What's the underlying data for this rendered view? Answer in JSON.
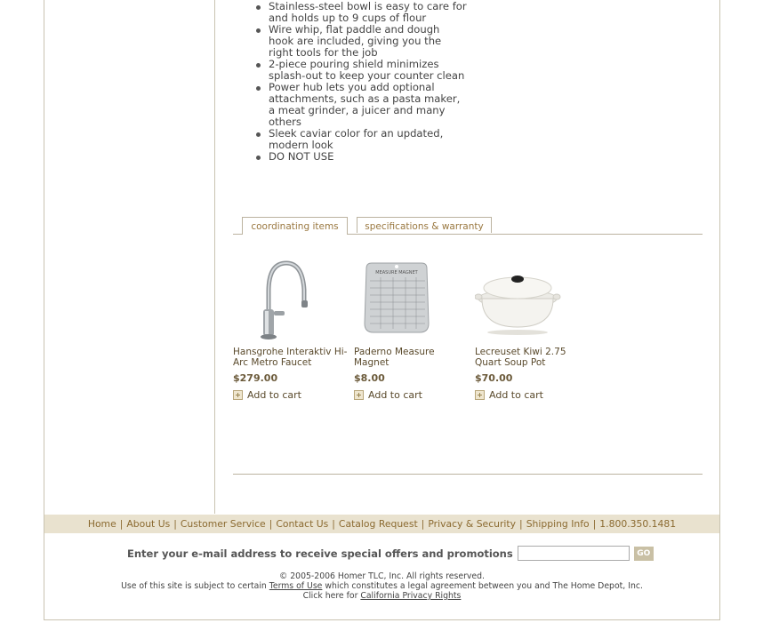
{
  "features": [
    "Stainless-steel bowl is easy to care for and holds up to 9 cups of flour",
    "Wire whip, flat paddle and dough hook are included, giving you the right tools for the job",
    "2-piece pouring shield minimizes splash-out to keep your counter clean",
    "Power hub lets you add optional attachments, such as a pasta maker, a meat grinder, a juicer and many others",
    "Sleek caviar color for an updated, modern look",
    "DO NOT USE"
  ],
  "tabs": [
    "coordinating items",
    "specifications & warranty"
  ],
  "products": [
    {
      "name": "Hansgrohe Interaktiv Hi-Arc Metro Faucet",
      "price": "$279.00",
      "add": "Add to cart",
      "image": "faucet"
    },
    {
      "name": "Paderno Measure Magnet",
      "price": "$8.00",
      "add": "Add to cart",
      "image": "measure-magnet"
    },
    {
      "name": "Lecreuset Kiwi 2.75 Quart Soup Pot",
      "price": "$70.00",
      "add": "Add to cart",
      "image": "soup-pot"
    }
  ],
  "magnet_text": "MEASURE MAGNET",
  "footer_nav": [
    "Home",
    "About Us",
    "Customer Service",
    "Contact Us",
    "Catalog Request",
    "Privacy & Security",
    "Shipping Info",
    "1.800.350.1481"
  ],
  "signup": {
    "label": "Enter your e-mail address to receive special offers and promotions",
    "button": "GO",
    "placeholder": ""
  },
  "legal": {
    "copyright": "© 2005-2006 Homer TLC, Inc. All rights reserved.",
    "terms_prefix": "Use of this site is subject to certain",
    "terms_link": "Terms of Use",
    "terms_suffix": "which constitutes a legal agreement between you and The Home Depot, Inc.",
    "privacy_prefix": "Click here for",
    "privacy_link": "California Privacy Rights"
  },
  "colors": {
    "accent": "#8b6a30",
    "footer_bg": "#e9e2cf",
    "border": "#c9c3b1"
  }
}
